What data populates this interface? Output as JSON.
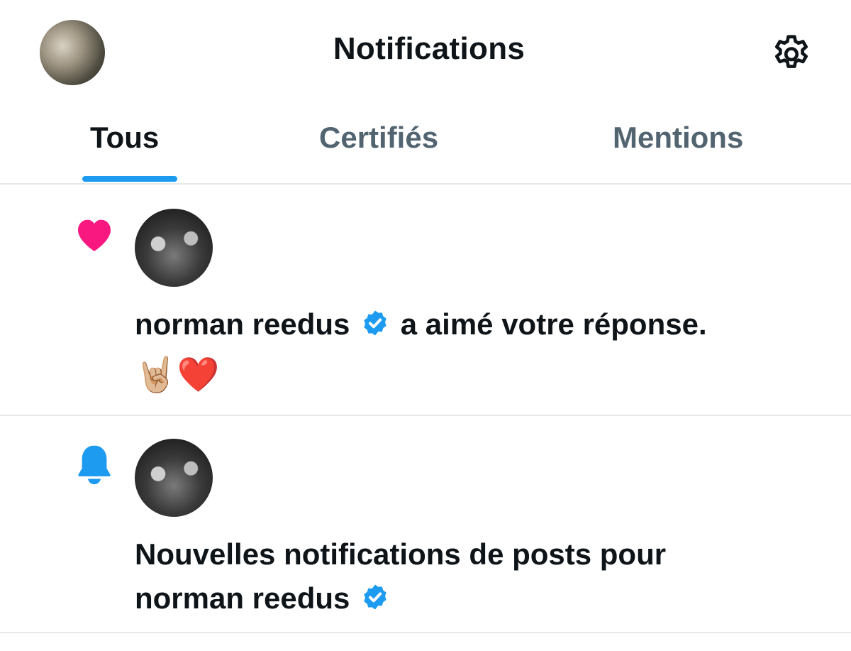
{
  "header": {
    "title": "Notifications",
    "avatar_icon": "user-avatar",
    "settings_icon": "gear-icon"
  },
  "tabs": [
    {
      "label": "Tous",
      "active": true
    },
    {
      "label": "Certifiés",
      "active": false
    },
    {
      "label": "Mentions",
      "active": false
    }
  ],
  "notifications": [
    {
      "type": "like",
      "icon": "heart-icon",
      "icon_color": "#f91880",
      "user": "norman reedus",
      "verified": true,
      "action": "a aimé votre réponse.",
      "content": "🤘🏼❤️"
    },
    {
      "type": "post-notification",
      "icon": "bell-icon",
      "icon_color": "#1d9bf0",
      "line1": "Nouvelles notifications de posts pour",
      "user": "norman reedus",
      "verified": true
    }
  ],
  "colors": {
    "accent": "#1d9bf0",
    "like": "#f91880",
    "text": "#0f1419",
    "muted": "#536471"
  }
}
